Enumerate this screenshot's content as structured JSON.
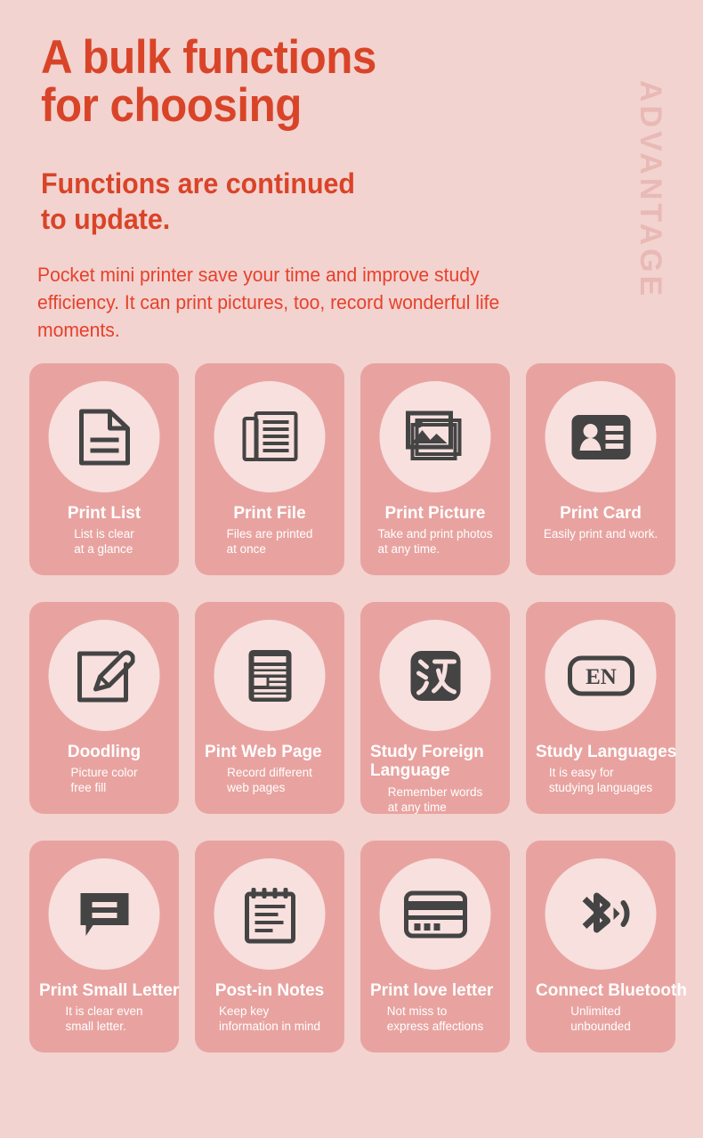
{
  "header": {
    "headline": "A bulk functions\nfor choosing",
    "subhead": "Functions are continued\nto update.",
    "lede": "Pocket mini printer save your time and improve study efficiency. It can print pictures, too, record wonderful life moments.",
    "vertical_label": "ADVANTAGE"
  },
  "colors": {
    "background": "#f2d3d0",
    "card": "#e8a3a0",
    "circle": "#f7e0de",
    "heading_red": "#d94428",
    "body_red": "#e8402a",
    "icon_dark": "#444444",
    "card_text": "#ffffff",
    "vertical_label": "#e9b9b6"
  },
  "cards": [
    {
      "title": "Print List",
      "subtitle": "List is clear\nat a glance",
      "icon": "document-lines-icon",
      "wrap": false
    },
    {
      "title": "Print File",
      "subtitle": "Files are printed\nat once",
      "icon": "stacked-documents-icon",
      "wrap": false
    },
    {
      "title": "Print Picture",
      "subtitle": "Take and print photos\nat any time.",
      "icon": "photo-stack-icon",
      "wrap": false
    },
    {
      "title": "Print Card",
      "subtitle": "Easily print and work.",
      "icon": "id-card-icon",
      "wrap": false
    },
    {
      "title": "Doodling",
      "subtitle": "Picture color\nfree fill",
      "icon": "pencil-edit-square-icon",
      "wrap": false
    },
    {
      "title": "Pint Web Page",
      "subtitle": "Record different\nweb pages",
      "icon": "web-page-icon",
      "wrap": true
    },
    {
      "title": "Study Foreign Language",
      "subtitle": "Remember words\nat any time",
      "icon": "chinese-character-han-icon",
      "wrap": true
    },
    {
      "title": "Study Languages",
      "subtitle": "It is easy for\nstudying languages",
      "icon": "english-en-badge-icon",
      "wrap": true
    },
    {
      "title": "Print Small Letter",
      "subtitle": "It is clear even\nsmall letter.",
      "icon": "speech-bubble-lines-icon",
      "wrap": true
    },
    {
      "title": "Post-in Notes",
      "subtitle": "Keep key\ninformation in mind",
      "icon": "notepad-spiral-icon",
      "wrap": false
    },
    {
      "title": "Print love letter",
      "subtitle": "Not miss to\nexpress affections",
      "icon": "credit-card-icon",
      "wrap": true
    },
    {
      "title": "Connect Bluetooth",
      "subtitle": "Unlimited\nunbounded",
      "icon": "bluetooth-signal-icon",
      "wrap": true
    }
  ]
}
